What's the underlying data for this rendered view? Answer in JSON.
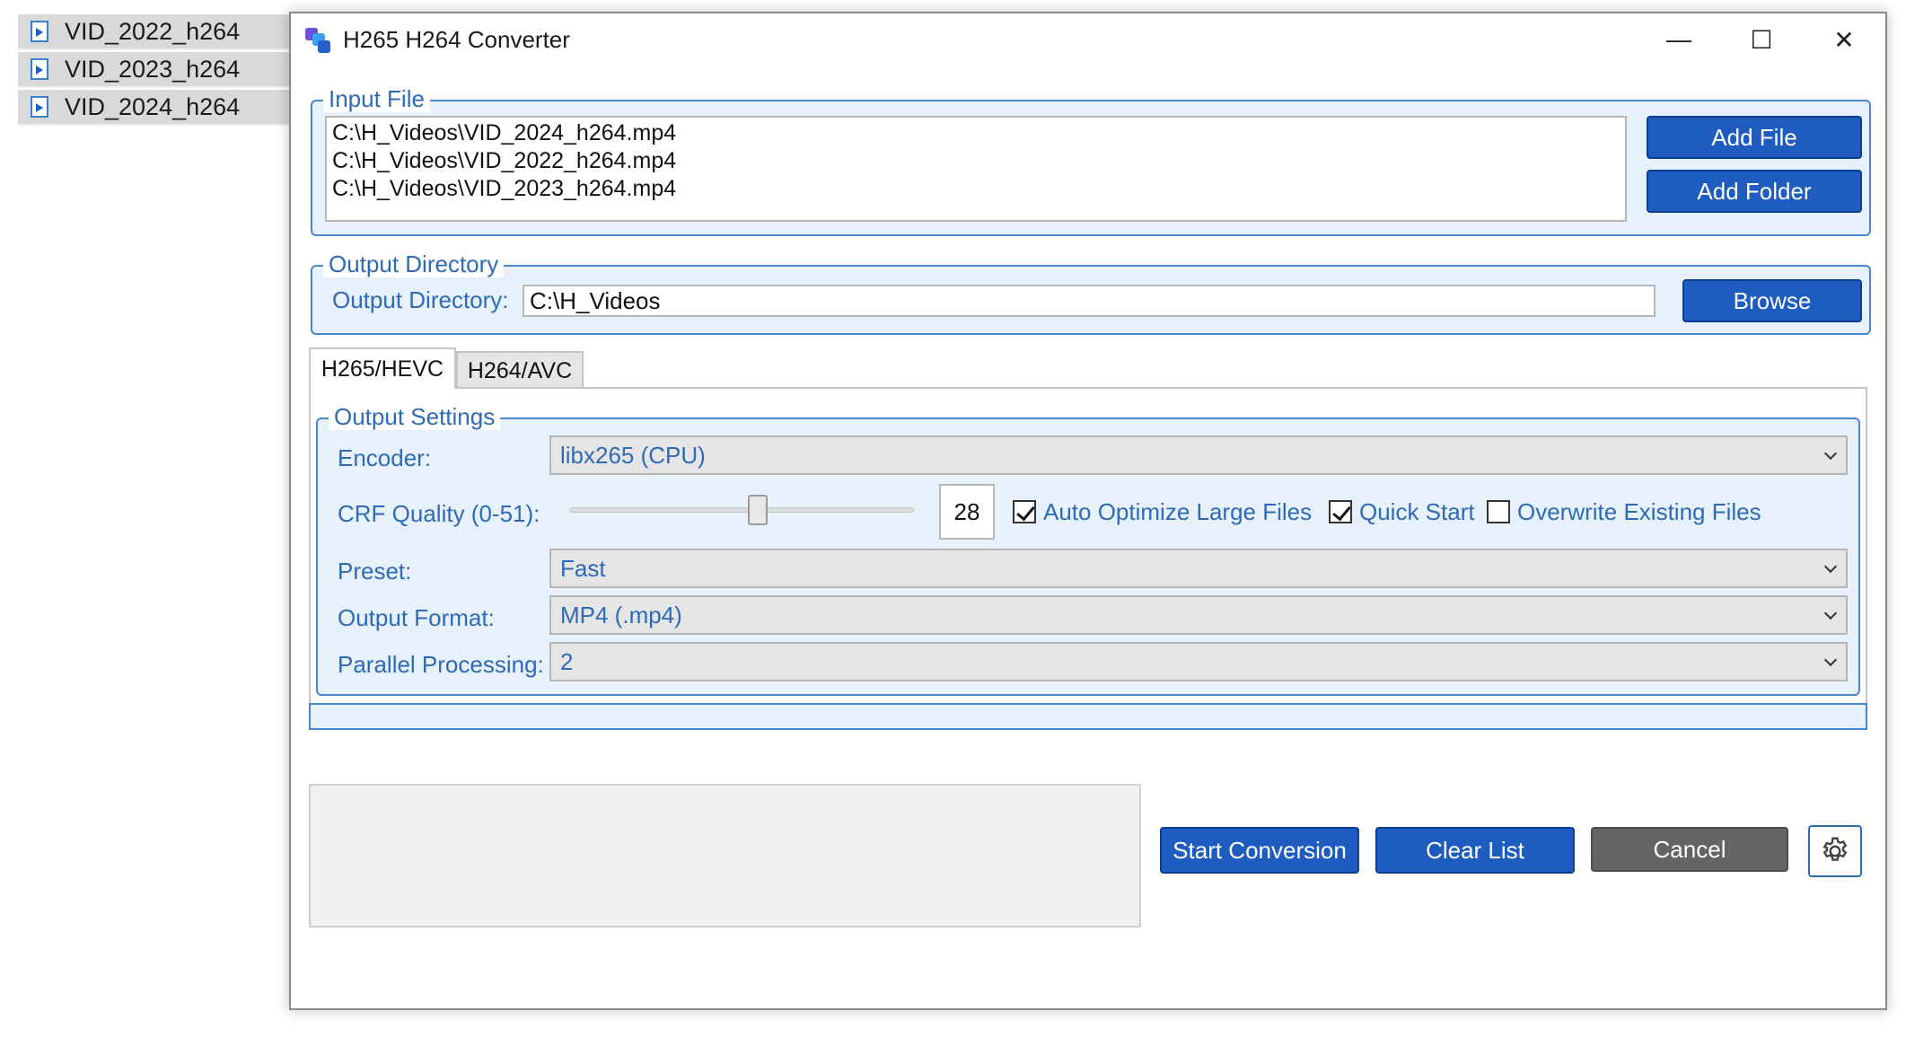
{
  "explorer": {
    "items": [
      {
        "label": "VID_2022_h264"
      },
      {
        "label": "VID_2023_h264"
      },
      {
        "label": "VID_2024_h264"
      }
    ]
  },
  "window": {
    "title": "H265 H264 Converter",
    "controls": {
      "minimize": "—",
      "maximize": "☐",
      "close": "✕"
    }
  },
  "input_file": {
    "group_label": "Input File",
    "files": [
      "C:\\H_Videos\\VID_2024_h264.mp4",
      "C:\\H_Videos\\VID_2022_h264.mp4",
      "C:\\H_Videos\\VID_2023_h264.mp4"
    ],
    "add_file_label": "Add File",
    "add_folder_label": "Add Folder"
  },
  "output_directory": {
    "group_label": "Output Directory",
    "field_label": "Output Directory:",
    "value": "C:\\H_Videos",
    "browse_label": "Browse"
  },
  "tabs": [
    {
      "label": "H265/HEVC",
      "active": true
    },
    {
      "label": "H264/AVC",
      "active": false
    }
  ],
  "output_settings": {
    "group_label": "Output Settings",
    "encoder_label": "Encoder:",
    "encoder_value": "libx265 (CPU)",
    "crf_label": "CRF Quality (0-51):",
    "crf_value": "28",
    "crf_min": 0,
    "crf_max": 51,
    "auto_optimize_label": "Auto Optimize Large Files",
    "auto_optimize_checked": true,
    "quick_start_label": "Quick Start",
    "quick_start_checked": true,
    "overwrite_label": "Overwrite Existing Files",
    "overwrite_checked": false,
    "preset_label": "Preset:",
    "preset_value": "Fast",
    "format_label": "Output Format:",
    "format_value": "MP4 (.mp4)",
    "parallel_label": "Parallel Processing:",
    "parallel_value": "2"
  },
  "actions": {
    "start_label": "Start Conversion",
    "clear_label": "Clear List",
    "cancel_label": "Cancel",
    "settings_icon": "gear-icon"
  },
  "colors": {
    "accent": "#1f5cc0",
    "group_border": "#4a86d0",
    "label_text": "#2f6ab7",
    "cancel_grey": "#646464"
  }
}
